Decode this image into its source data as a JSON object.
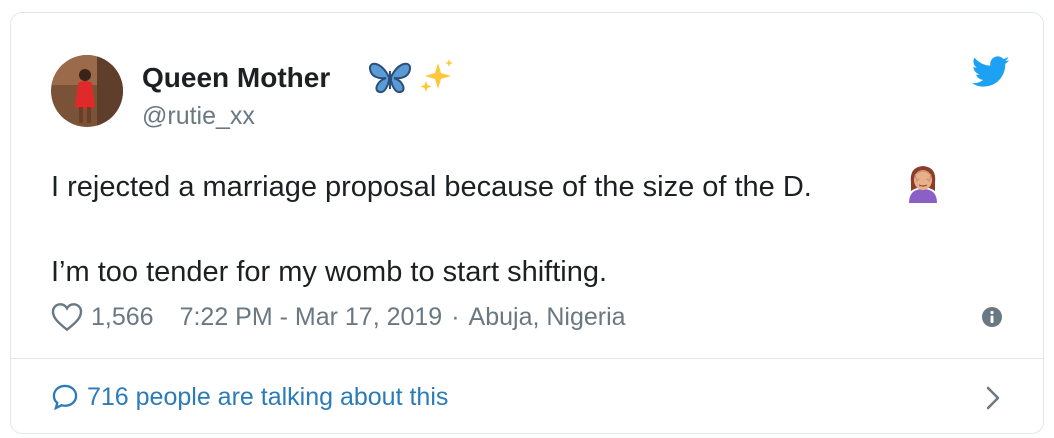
{
  "tweet": {
    "display_name": "Queen Mother",
    "name_emojis": [
      "butterfly-emoji",
      "sparkles-emoji"
    ],
    "handle": "@rutie_xx",
    "text_line1": "I rejected a marriage proposal because of the size of the D.",
    "text_line1_emoji": "woman-facepalming-emoji",
    "text_line2": "I’m too tender for my womb to start shifting.",
    "likes": "1,566",
    "timestamp": "7:22 PM - Mar 17, 2019",
    "separator": "·",
    "location": "Abuja, Nigeria",
    "talking": "716 people are talking about this"
  },
  "colors": {
    "twitter_blue": "#1da1f2",
    "link_blue": "#2b7bb9",
    "muted": "#697882",
    "border": "#e1e8ed"
  }
}
